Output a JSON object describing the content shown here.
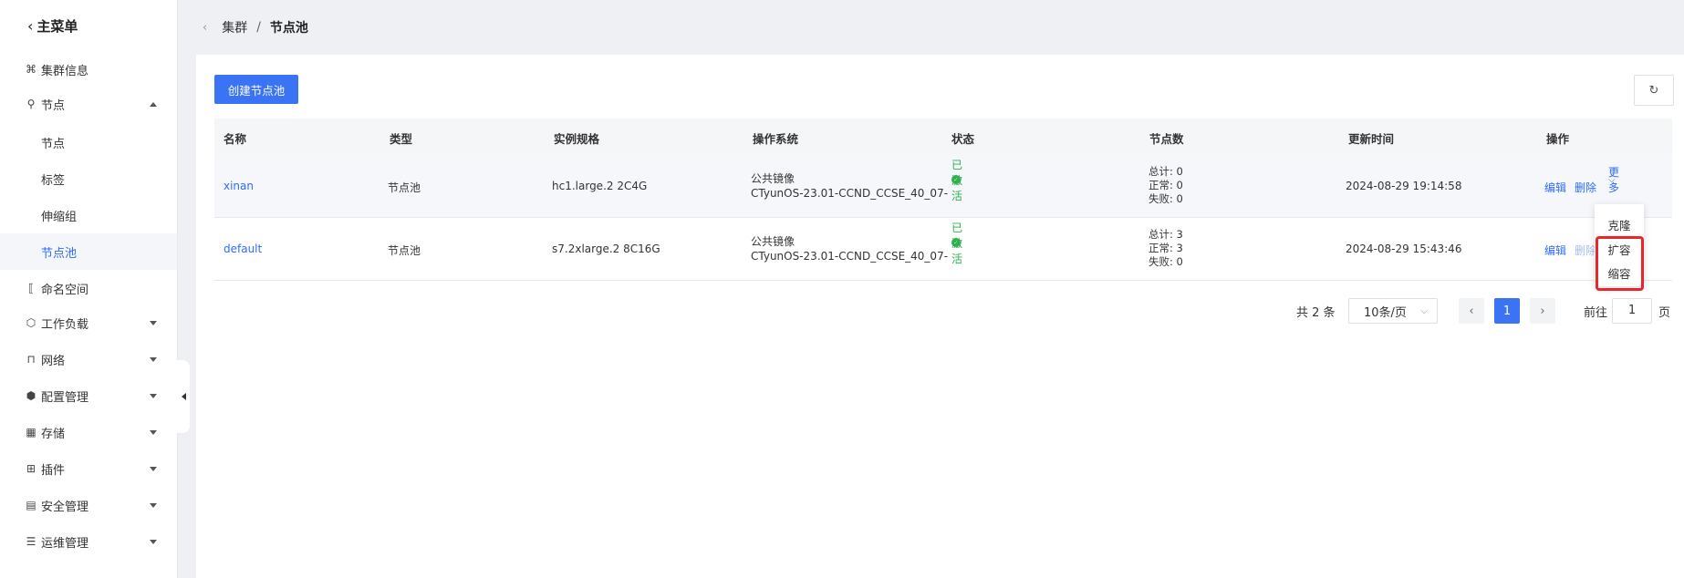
{
  "sidebar": {
    "back_label": "主菜单",
    "items": [
      {
        "label": "集群信息"
      },
      {
        "label": "节点"
      },
      {
        "label": "节点"
      },
      {
        "label": "标签"
      },
      {
        "label": "伸缩组"
      },
      {
        "label": "节点池"
      },
      {
        "label": "命名空间"
      },
      {
        "label": "工作负载"
      },
      {
        "label": "网络"
      },
      {
        "label": "配置管理"
      },
      {
        "label": "存储"
      },
      {
        "label": "插件"
      },
      {
        "label": "安全管理"
      },
      {
        "label": "运维管理"
      }
    ]
  },
  "breadcrumb": {
    "parent": "集群",
    "separator": "/",
    "current": "节点池"
  },
  "toolbar": {
    "create_label": "创建节点池",
    "refresh_icon": "refresh-icon"
  },
  "table": {
    "headers": [
      "名称",
      "类型",
      "实例规格",
      "操作系统",
      "状态",
      "节点数",
      "更新时间",
      "操作"
    ],
    "rows": [
      {
        "name": "xinan",
        "type": "节点池",
        "spec": "hc1.large.2 2C4G",
        "os_line1": "公共镜像",
        "os_line2": "CTyunOS-23.01-CCND_CCSE_40_07-",
        "status": "已激活",
        "total": "总计: 0",
        "normal": "正常: 0",
        "failed": "失败: 0",
        "updated": "2024-08-29 19:14:58",
        "op_edit": "编辑",
        "op_delete": "删除",
        "op_more": "更多"
      },
      {
        "name": "default",
        "type": "节点池",
        "spec": "s7.2xlarge.2 8C16G",
        "os_line1": "公共镜像",
        "os_line2": "CTyunOS-23.01-CCND_CCSE_40_07-",
        "status": "已激活",
        "total": "总计: 3",
        "normal": "正常: 3",
        "failed": "失败: 0",
        "updated": "2024-08-29 15:43:46",
        "op_edit": "编辑",
        "op_delete": "删除"
      }
    ]
  },
  "dropdown": {
    "items": [
      "克隆",
      "扩容",
      "缩容"
    ]
  },
  "pagination": {
    "total": "共 2 条",
    "page_size": "10条/页",
    "current_page": "1",
    "goto_prefix": "前往",
    "goto_value": "1",
    "goto_suffix": "页"
  },
  "colors": {
    "accent": "#3b73f5",
    "success": "#2fb050",
    "highlight": "#e8262c"
  }
}
